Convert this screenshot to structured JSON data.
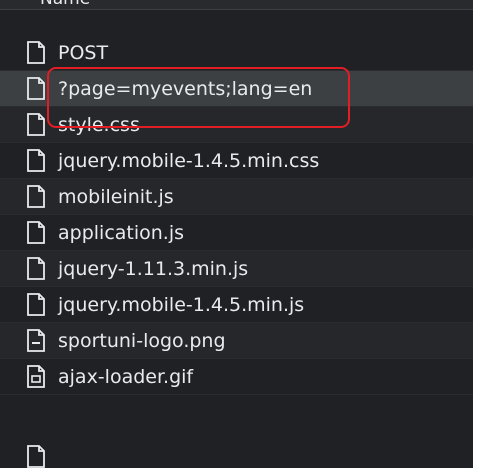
{
  "header": {
    "label": "Name"
  },
  "files": [
    {
      "name": "POST",
      "icon": "document-icon"
    },
    {
      "name": "?page=myevents;lang=en",
      "icon": "document-icon",
      "selected": true
    },
    {
      "name": "style.css",
      "icon": "document-icon"
    },
    {
      "name": "jquery.mobile-1.4.5.min.css",
      "icon": "document-icon"
    },
    {
      "name": "mobileinit.js",
      "icon": "document-icon"
    },
    {
      "name": "application.js",
      "icon": "document-icon"
    },
    {
      "name": "jquery-1.11.3.min.js",
      "icon": "document-icon"
    },
    {
      "name": "jquery.mobile-1.4.5.min.js",
      "icon": "document-icon"
    },
    {
      "name": "sportuni-logo.png",
      "icon": "image-icon"
    },
    {
      "name": "ajax-loader.gif",
      "icon": "image-icon"
    }
  ],
  "colors": {
    "panel_bg": "#202124",
    "row_selected": "#3c4043",
    "text": "#e8eaed",
    "highlight": "#e01e24"
  }
}
